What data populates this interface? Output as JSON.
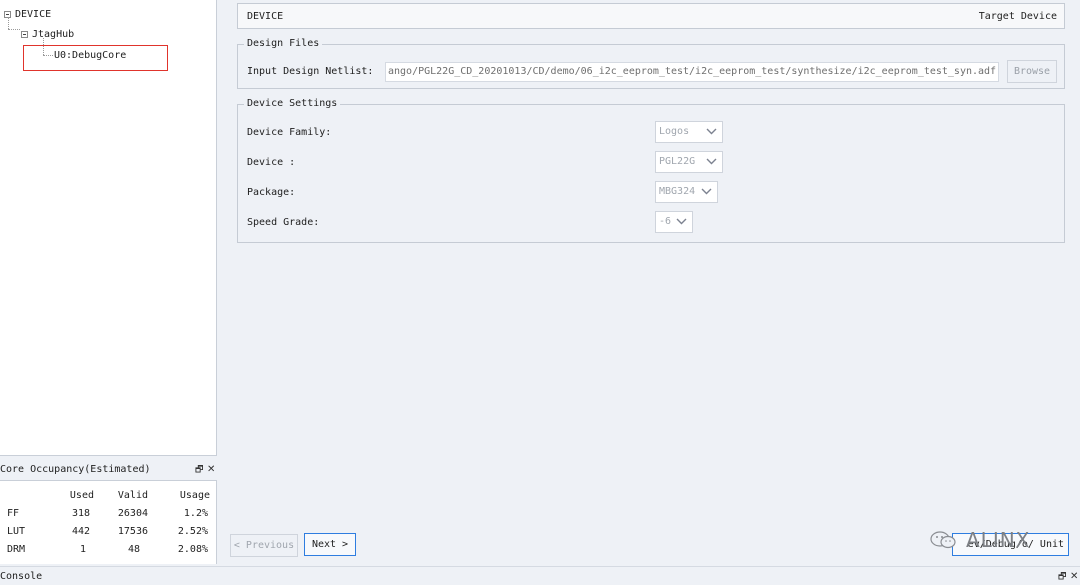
{
  "tree": {
    "root": "DEVICE",
    "child": "JtagHub",
    "leaf": "U0:DebugCore"
  },
  "occupancy": {
    "title": "Core Occupancy(Estimated)",
    "columns": [
      "Used",
      "Valid",
      "Usage"
    ],
    "rows": [
      {
        "name": "FF",
        "used": "318",
        "valid": "26304",
        "usage": "1.2%"
      },
      {
        "name": "LUT",
        "used": "442",
        "valid": "17536",
        "usage": "2.52%"
      },
      {
        "name": "DRM",
        "used": "1",
        "valid": "48",
        "usage": "2.08%"
      }
    ]
  },
  "header": {
    "left": "DEVICE",
    "right": "Target Device"
  },
  "design_files": {
    "legend": "Design Files",
    "netlist_label": "Input Design Netlist:",
    "netlist_value": "ango/PGL22G_CD_20201013/CD/demo/06_i2c_eeprom_test/i2c_eeprom_test/synthesize/i2c_eeprom_test_syn.adf",
    "browse_label": "Browse"
  },
  "device_settings": {
    "legend": "Device Settings",
    "fields": [
      {
        "label": "Device Family:",
        "value": "Logos"
      },
      {
        "label": "Device :",
        "value": "PGL22G"
      },
      {
        "label": "Package:",
        "value": "MBG324"
      },
      {
        "label": "Speed Grade:",
        "value": "-6"
      }
    ]
  },
  "buttons": {
    "previous": "< Previous",
    "next": "Next >",
    "unit": "ev/Debug/o/ Unit"
  },
  "watermark": "ALINX",
  "console": {
    "title": "Console"
  },
  "icons": {
    "restore": "restore-icon",
    "close": "close-icon",
    "expander": "collapse-icon",
    "chevron": "chevron-down-icon"
  },
  "colors": {
    "accent": "#2e7de0",
    "highlight": "#e0342c",
    "background": "#eef1f6"
  }
}
